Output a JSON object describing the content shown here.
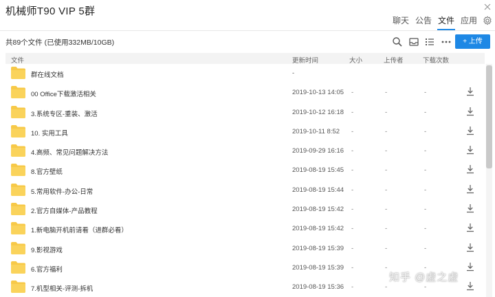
{
  "window": {
    "title": "机械师T90 VIP 5群"
  },
  "tabs": [
    {
      "label": "聊天"
    },
    {
      "label": "公告"
    },
    {
      "label": "文件"
    },
    {
      "label": "应用"
    }
  ],
  "icons": {
    "gear": "gear-icon",
    "search": "search-icon",
    "inbox": "inbox-icon",
    "list": "list-view-icon",
    "more": "more-icon",
    "download": "download-icon",
    "folder": "folder-icon"
  },
  "colors": {
    "accent": "#1e88e5",
    "folder": "#f7c948"
  },
  "toolbar": {
    "file_count": "共89个文件 (已使用332MB/10GB)",
    "upload_label": "+ 上传"
  },
  "table": {
    "headers": {
      "name": "文件",
      "date": "更新时间",
      "size": "大小",
      "uploader": "上传者",
      "downloads": "下载次数"
    },
    "rows": [
      {
        "name": "群在线文档",
        "date": "-",
        "size": "",
        "uploader": "",
        "downloads": "",
        "download": false
      },
      {
        "name": "00 Office下载激活相关",
        "date": "2019-10-13 14:05",
        "size": "-",
        "uploader": "-",
        "downloads": "-",
        "download": true
      },
      {
        "name": "3.系统专区-重装、激活",
        "date": "2019-10-12 16:18",
        "size": "-",
        "uploader": "-",
        "downloads": "-",
        "download": true
      },
      {
        "name": "10. 实用工具",
        "date": "2019-10-11 8:52",
        "size": "-",
        "uploader": "-",
        "downloads": "-",
        "download": true
      },
      {
        "name": "4.高频、常见问题解决方法",
        "date": "2019-09-29 16:16",
        "size": "-",
        "uploader": "-",
        "downloads": "-",
        "download": true
      },
      {
        "name": "8.官方壁纸",
        "date": "2019-08-19 15:45",
        "size": "-",
        "uploader": "-",
        "downloads": "-",
        "download": true
      },
      {
        "name": "5.常用软件-办公-日常",
        "date": "2019-08-19 15:44",
        "size": "-",
        "uploader": "-",
        "downloads": "-",
        "download": true
      },
      {
        "name": "2.官方自媒体-产品教程",
        "date": "2019-08-19 15:42",
        "size": "-",
        "uploader": "-",
        "downloads": "-",
        "download": true
      },
      {
        "name": "1.新电脑开机前请看（进群必看）",
        "date": "2019-08-19 15:42",
        "size": "-",
        "uploader": "-",
        "downloads": "-",
        "download": true
      },
      {
        "name": "9.影视游戏",
        "date": "2019-08-19 15:39",
        "size": "-",
        "uploader": "-",
        "downloads": "-",
        "download": true
      },
      {
        "name": "6.官方福利",
        "date": "2019-08-19 15:39",
        "size": "-",
        "uploader": "-",
        "downloads": "-",
        "download": true
      },
      {
        "name": "7.机型相关-评测-拆机",
        "date": "2019-08-19 15:36",
        "size": "-",
        "uploader": "-",
        "downloads": "-",
        "download": true
      }
    ]
  },
  "watermark": "知乎 @虚之虚"
}
